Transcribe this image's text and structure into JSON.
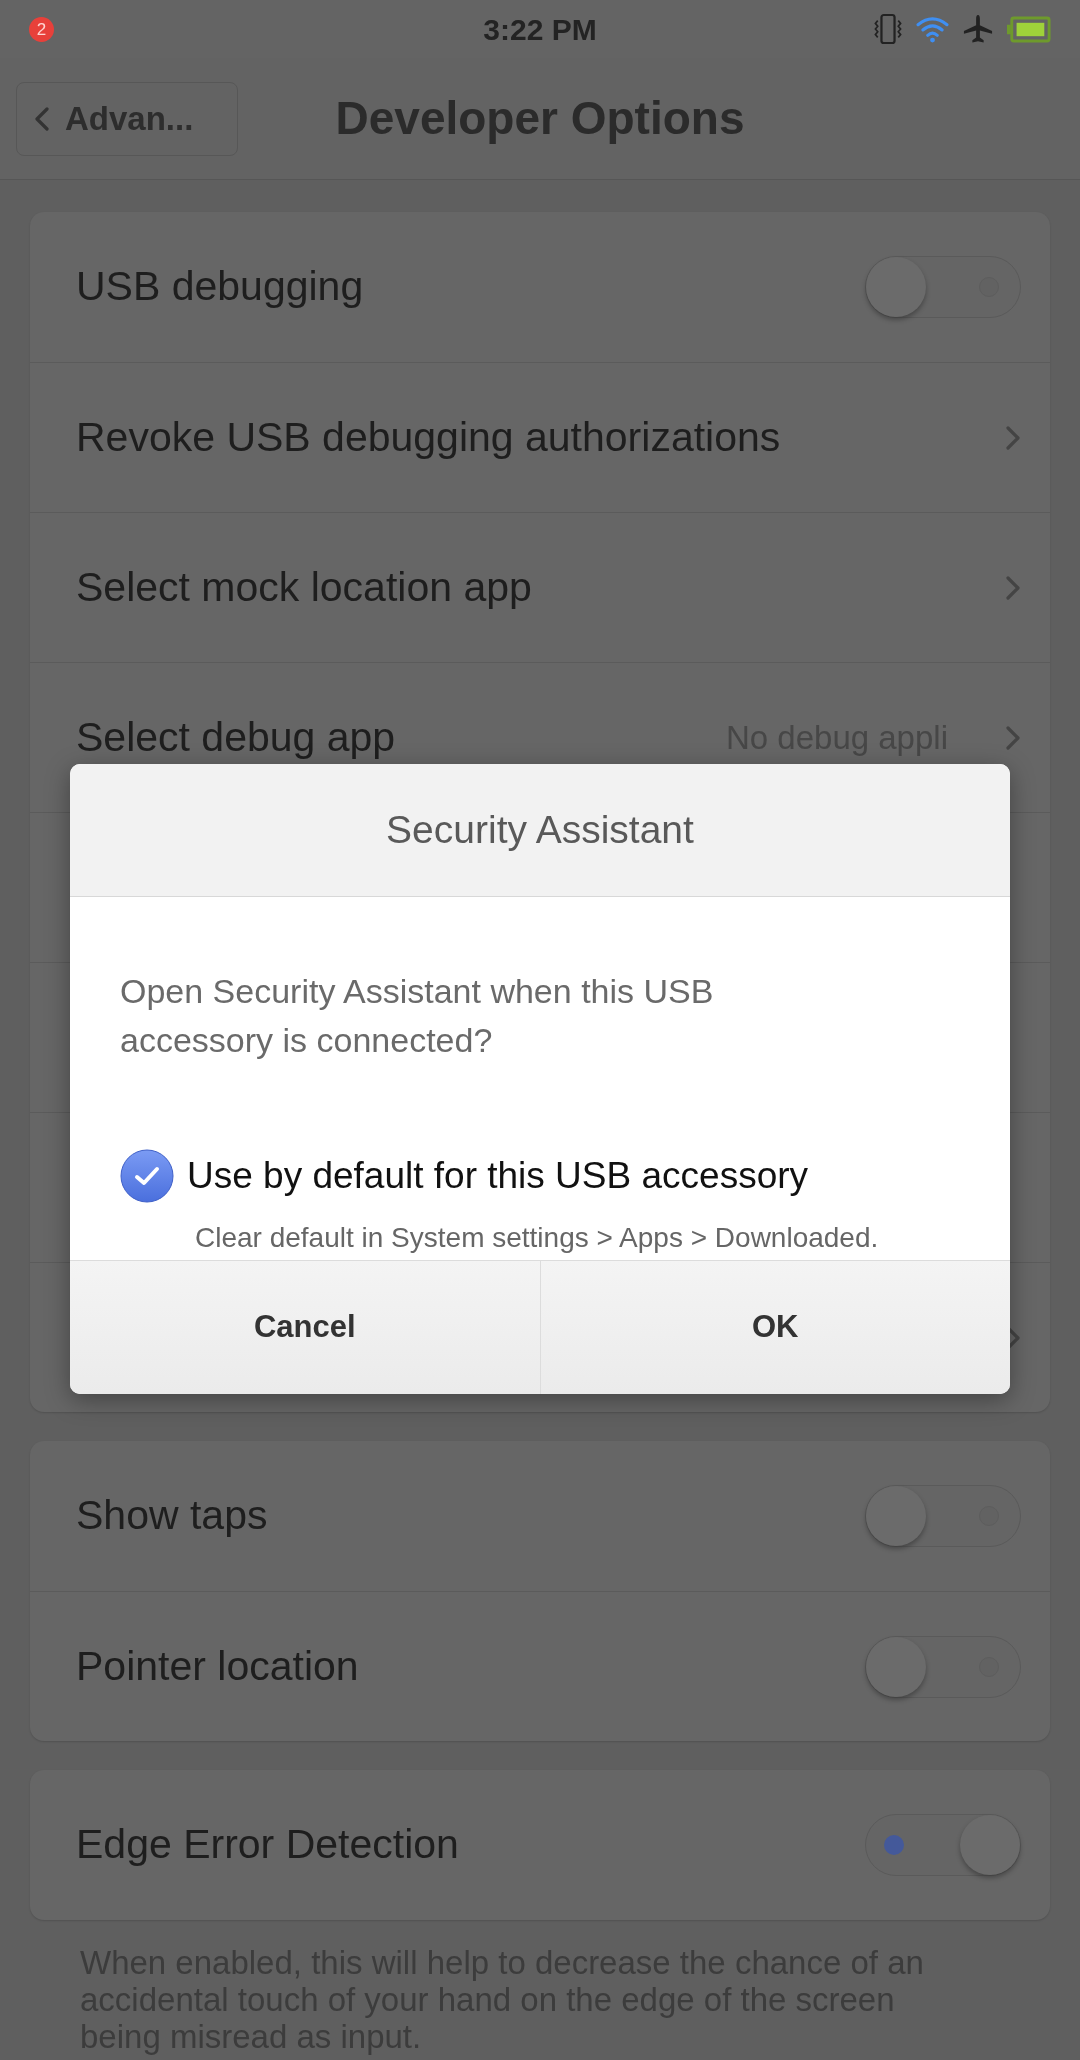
{
  "status_bar": {
    "notification_count": "2",
    "time": "3:22 PM"
  },
  "header": {
    "back_label": "Advan...",
    "title": "Developer Options"
  },
  "groups": [
    {
      "items": [
        {
          "kind": "toggle",
          "label": "USB debugging",
          "on": false
        },
        {
          "kind": "link",
          "label": "Revoke USB debugging authorizations"
        },
        {
          "kind": "link",
          "label": "Select mock location app"
        },
        {
          "kind": "link",
          "label": "Select debug app",
          "value": "No debug appli"
        },
        {
          "kind": "hidden"
        },
        {
          "kind": "hidden"
        },
        {
          "kind": "hidden"
        },
        {
          "kind": "hidden_link"
        }
      ]
    },
    {
      "items": [
        {
          "kind": "toggle",
          "label": "Show taps",
          "on": false
        },
        {
          "kind": "toggle",
          "label": "Pointer location",
          "on": false
        }
      ]
    },
    {
      "items": [
        {
          "kind": "toggle",
          "label": "Edge Error Detection",
          "on": true
        }
      ]
    }
  ],
  "footer_note": "When enabled, this will help to decrease the chance of an accidental touch of your hand on the edge of the screen being misread as input.",
  "dialog": {
    "title": "Security Assistant",
    "message": "Open Security Assistant when this USB accessory is connected?",
    "checkbox": {
      "label": "Use by default for this USB accessory",
      "checked": true
    },
    "hint": "Clear default in System settings > Apps > Downloaded.",
    "buttons": [
      "Cancel",
      "OK"
    ]
  }
}
